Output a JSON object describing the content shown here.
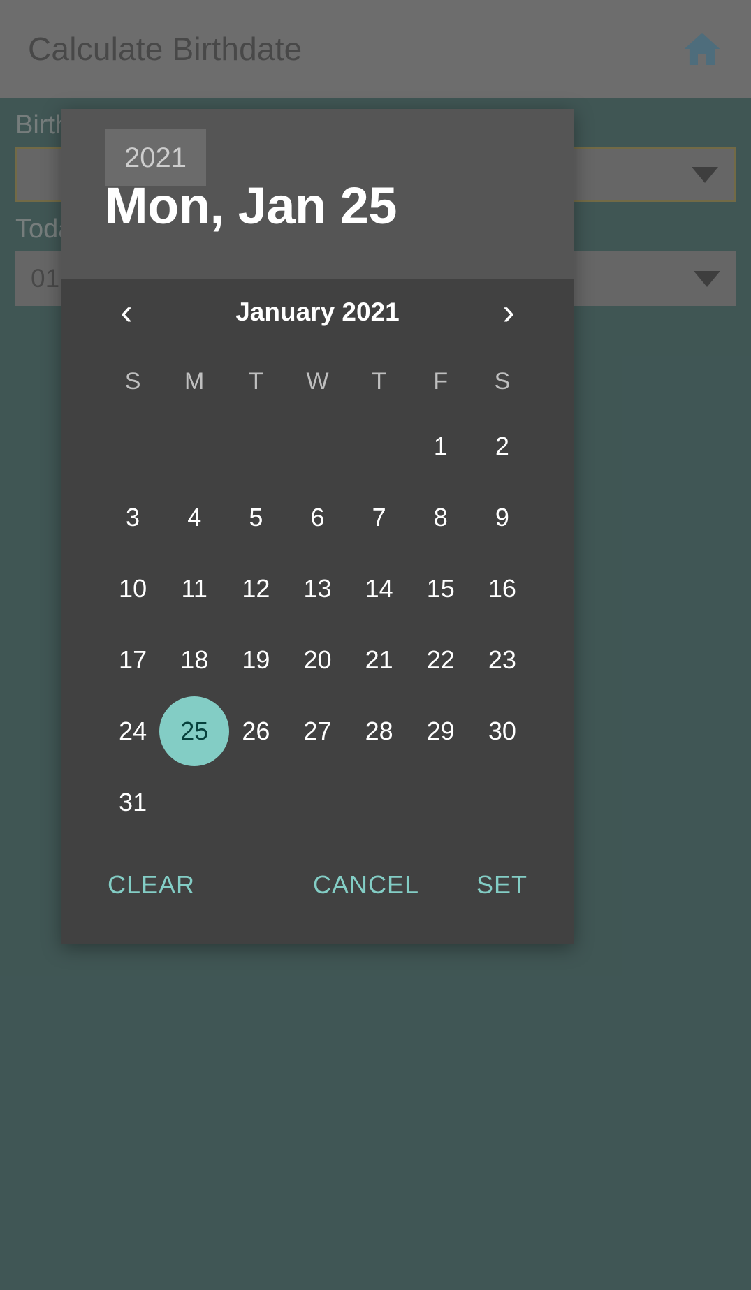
{
  "app": {
    "title": "Calculate Birthdate",
    "home_icon": "home-icon",
    "background_color": "#06403c",
    "appbar_color": "#7c7c7c"
  },
  "form": {
    "fields": [
      {
        "label": "Birthdate",
        "value": "",
        "caret": "caret-down-icon",
        "highlighted": true
      },
      {
        "label": "Today's Date",
        "value": "01",
        "caret": "caret-down-icon",
        "highlighted": false
      }
    ]
  },
  "dialog": {
    "header": {
      "year": "2021",
      "date": "Mon, Jan 25"
    },
    "month_label": "January 2021",
    "prev_arrow": "chevron-left-icon",
    "next_arrow": "chevron-right-icon",
    "weekdays": [
      "S",
      "M",
      "T",
      "W",
      "T",
      "F",
      "S"
    ],
    "days": [
      "",
      "",
      "",
      "",
      "",
      "1",
      "2",
      "3",
      "4",
      "5",
      "6",
      "7",
      "8",
      "9",
      "10",
      "11",
      "12",
      "13",
      "14",
      "15",
      "16",
      "17",
      "18",
      "19",
      "20",
      "21",
      "22",
      "23",
      "24",
      "25",
      "26",
      "27",
      "28",
      "29",
      "30",
      "31",
      "",
      "",
      "",
      "",
      "",
      ""
    ],
    "selected_day": "25",
    "accent_color": "#83cdc5",
    "actions": {
      "clear": "CLEAR",
      "cancel": "CANCEL",
      "set": "SET"
    }
  }
}
